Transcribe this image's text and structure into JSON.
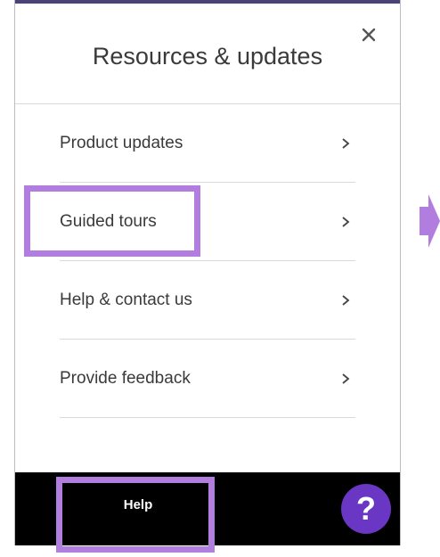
{
  "panel": {
    "title": "Resources & updates",
    "close_icon": "close-icon",
    "items": [
      {
        "label": "Product updates",
        "icon": "chevron-right-icon"
      },
      {
        "label": "Guided tours",
        "icon": "chevron-right-icon"
      },
      {
        "label": "Help & contact us",
        "icon": "chevron-right-icon"
      },
      {
        "label": "Provide feedback",
        "icon": "chevron-right-icon"
      }
    ]
  },
  "footer": {
    "help_label": "Help",
    "help_fab_label": "?"
  },
  "annotations": {
    "highlight_color": "#b17ee0",
    "arrow_icon": "arrow-right-icon"
  },
  "colors": {
    "accent_purple": "#6a36c4",
    "top_bar": "#4b4276",
    "footer_bg": "#000000",
    "text": "#3a3a3a"
  }
}
